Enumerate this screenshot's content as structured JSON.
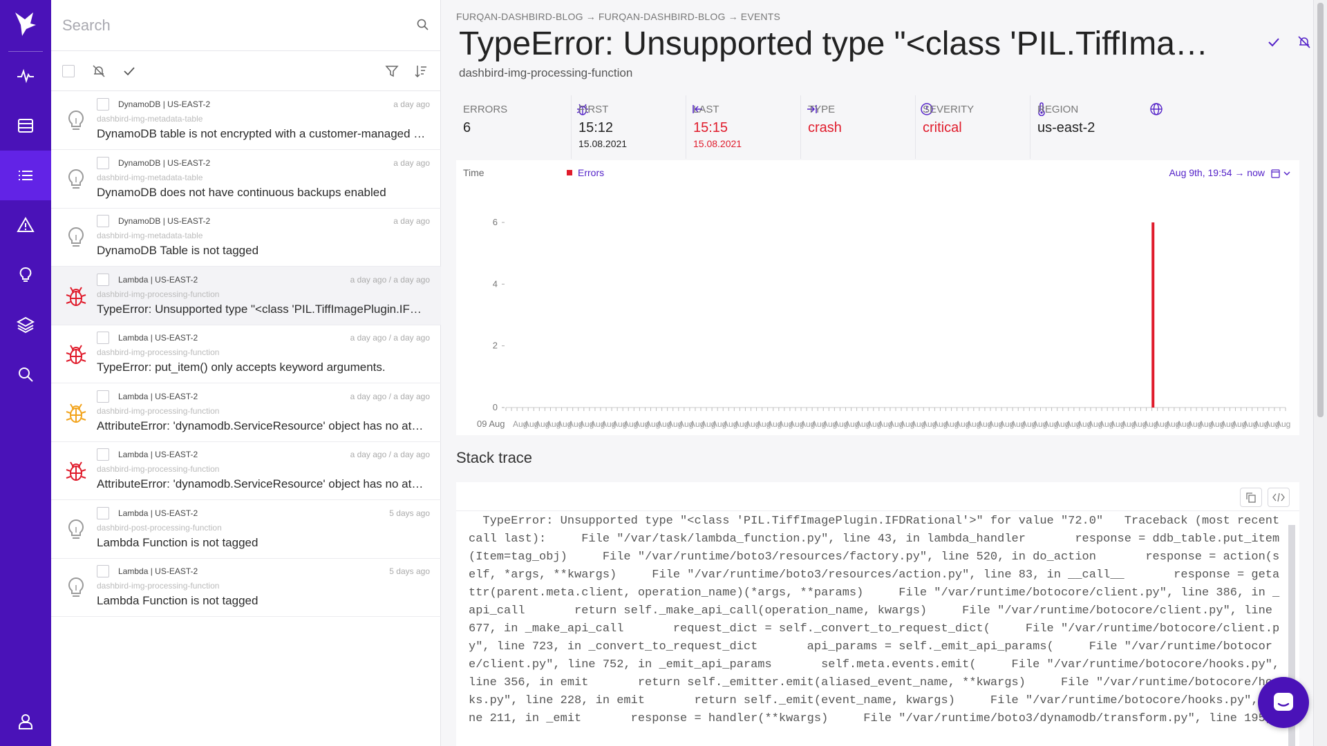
{
  "search": {
    "placeholder": "Search"
  },
  "items": [
    {
      "source": "DynamoDB | US-EAST-2",
      "time": "a day ago",
      "resource": "dashbird-img-metadata-table",
      "title": "DynamoDB table is not encrypted with a customer-managed key",
      "icon": "lightbulb-icon",
      "icon_color": "#9a9a9a"
    },
    {
      "source": "DynamoDB | US-EAST-2",
      "time": "a day ago",
      "resource": "dashbird-img-metadata-table",
      "title": "DynamoDB does not have continuous backups enabled",
      "icon": "lightbulb-icon",
      "icon_color": "#9a9a9a"
    },
    {
      "source": "DynamoDB | US-EAST-2",
      "time": "a day ago",
      "resource": "dashbird-img-metadata-table",
      "title": "DynamoDB Table is not tagged",
      "icon": "lightbulb-icon",
      "icon_color": "#9a9a9a"
    },
    {
      "source": "Lambda | US-EAST-2",
      "time": "a day ago / a day ago",
      "resource": "dashbird-img-processing-function",
      "title": "TypeError: Unsupported type \"<class 'PIL.TiffImagePlugin.IFDRational'>\" for value \"72.0\"",
      "icon": "bug-icon",
      "icon_color": "#e01b2b"
    },
    {
      "source": "Lambda | US-EAST-2",
      "time": "a day ago / a day ago",
      "resource": "dashbird-img-processing-function",
      "title": "TypeError: put_item() only accepts keyword arguments.",
      "icon": "bug-icon",
      "icon_color": "#e01b2b"
    },
    {
      "source": "Lambda | US-EAST-2",
      "time": "a day ago / a day ago",
      "resource": "dashbird-img-processing-function",
      "title": "AttributeError: 'dynamodb.ServiceResource' object has no attribute 'put_item'",
      "icon": "bug-icon",
      "icon_color": "#f2a31b"
    },
    {
      "source": "Lambda | US-EAST-2",
      "time": "a day ago / a day ago",
      "resource": "dashbird-img-processing-function",
      "title": "AttributeError: 'dynamodb.ServiceResource' object has no attribute 'Table'",
      "icon": "bug-icon",
      "icon_color": "#e01b2b"
    },
    {
      "source": "Lambda | US-EAST-2",
      "time": "5 days ago",
      "resource": "dashbird-post-processing-function",
      "title": "Lambda Function is not tagged",
      "icon": "lightbulb-icon",
      "icon_color": "#9a9a9a"
    },
    {
      "source": "Lambda | US-EAST-2",
      "time": "5 days ago",
      "resource": "dashbird-img-processing-function",
      "title": "Lambda Function is not tagged",
      "icon": "lightbulb-icon",
      "icon_color": "#9a9a9a"
    }
  ],
  "breadcrumb": {
    "part1": "FURQAN-DASHBIRD-BLOG",
    "part2": "FURQAN-DASHBIRD-BLOG",
    "part3": "EVENTS",
    "arrow": "→"
  },
  "event": {
    "title": "TypeError: Unsupported type \"<class 'PIL.TiffImagePlugin.IFDRational'>\" for value \"72.0\"",
    "function": "dashbird-img-processing-function"
  },
  "stats": {
    "errors": {
      "label": "ERRORS",
      "value": "6"
    },
    "first": {
      "label": "FIRST",
      "value": "15:12",
      "date": "15.08.2021"
    },
    "last": {
      "label": "LAST",
      "value": "15:15",
      "date": "15.08.2021"
    },
    "type": {
      "label": "TYPE",
      "value": "crash"
    },
    "severity": {
      "label": "SEVERITY",
      "value": "critical"
    },
    "region": {
      "label": "REGION",
      "value": "us-east-2"
    }
  },
  "chart_header": {
    "time_label": "Time",
    "legend": "Errors",
    "range": "Aug 9th, 19:54 → now"
  },
  "chart_data": {
    "type": "bar",
    "x_tick_first": "09 Aug",
    "series": [
      {
        "name": "Errors",
        "peak_value": 6,
        "peak_position_fraction": 0.83
      }
    ],
    "ylim": [
      0,
      6
    ],
    "yticks": [
      0,
      2,
      4,
      6
    ],
    "color": "#e01b2b"
  },
  "stack": {
    "label": "Stack trace",
    "text": "  TypeError: Unsupported type \"<class 'PIL.TiffImagePlugin.IFDRational'>\" for value \"72.0\"   Traceback (most recent call last):     File \"/var/task/lambda_function.py\", line 43, in lambda_handler       response = ddb_table.put_item(Item=tag_obj)     File \"/var/runtime/boto3/resources/factory.py\", line 520, in do_action       response = action(self, *args, **kwargs)     File \"/var/runtime/boto3/resources/action.py\", line 83, in __call__       response = getattr(parent.meta.client, operation_name)(*args, **params)     File \"/var/runtime/botocore/client.py\", line 386, in _api_call       return self._make_api_call(operation_name, kwargs)     File \"/var/runtime/botocore/client.py\", line 677, in _make_api_call       request_dict = self._convert_to_request_dict(     File \"/var/runtime/botocore/client.py\", line 723, in _convert_to_request_dict       api_params = self._emit_api_params(     File \"/var/runtime/botocore/client.py\", line 752, in _emit_api_params       self.meta.events.emit(     File \"/var/runtime/botocore/hooks.py\", line 356, in emit       return self._emitter.emit(aliased_event_name, **kwargs)     File \"/var/runtime/botocore/hooks.py\", line 228, in emit       return self._emit(event_name, kwargs)     File \"/var/runtime/botocore/hooks.py\", line 211, in _emit       response = handler(**kwargs)     File \"/var/runtime/boto3/dynamodb/transform.py\", line 195,"
  },
  "colors": {
    "brand": "#4a12b8",
    "accent": "#5321c8",
    "error": "#e01b2b",
    "warning": "#f2a31b"
  }
}
